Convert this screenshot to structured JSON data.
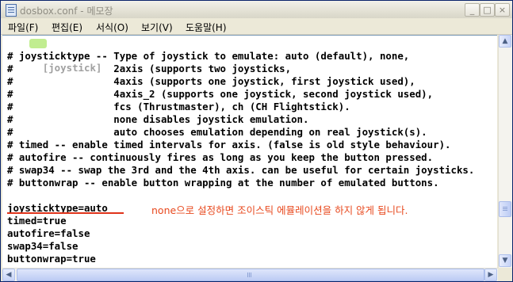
{
  "window": {
    "title": "dosbox.conf - 메모장",
    "buttons": {
      "minimize": "_",
      "maximize": "□",
      "close": "×"
    }
  },
  "menu": [
    {
      "label": "파일(F)"
    },
    {
      "label": "편집(E)"
    },
    {
      "label": "서식(O)"
    },
    {
      "label": "보기(V)"
    },
    {
      "label": "도움말(H)"
    }
  ],
  "editor": {
    "lines": [
      "[joystick]",
      "# joysticktype -- Type of joystick to emulate: auto (default), none,",
      "#                 2axis (supports two joysticks,",
      "#                 4axis (supports one joystick, first joystick used),",
      "#                 4axis_2 (supports one joystick, second joystick used),",
      "#                 fcs (Thrustmaster), ch (CH Flightstick).",
      "#                 none disables joystick emulation.",
      "#                 auto chooses emulation depending on real joystick(s).",
      "# timed -- enable timed intervals for axis. (false is old style behaviour).",
      "# autofire -- continuously fires as long as you keep the button pressed.",
      "# swap34 -- swap the 3rd and the 4th axis. can be useful for certain joysticks.",
      "# buttonwrap -- enable button wrapping at the number of emulated buttons.",
      "",
      "joysticktype=auto",
      "timed=true",
      "autofire=false",
      "swap34=false",
      "buttonwrap=true"
    ],
    "annotation": "none으로 설정하면 조이스틱 에뮬레이션을 하지 않게 됩니다.",
    "annotation_color": "#e8491e",
    "highlight_color": "#b6ea7c"
  },
  "scrollbar": {
    "up": "▲",
    "down": "▼",
    "left": "◀",
    "right": "▶"
  }
}
